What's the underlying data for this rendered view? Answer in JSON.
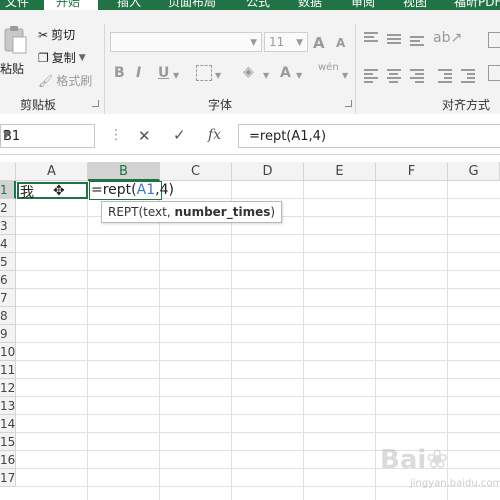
{
  "tabs": [
    {
      "label": "文件",
      "active": false
    },
    {
      "label": "开始",
      "active": true
    },
    {
      "label": "插入",
      "active": false
    },
    {
      "label": "页面布局",
      "active": false
    },
    {
      "label": "公式",
      "active": false
    },
    {
      "label": "数据",
      "active": false
    },
    {
      "label": "审阅",
      "active": false
    },
    {
      "label": "视图",
      "active": false
    },
    {
      "label": "福昕PDF",
      "active": false
    }
  ],
  "clipboard": {
    "paste_label": "粘贴",
    "cut_label": "剪切",
    "copy_label": "复制",
    "format_painter_label": "格式刷",
    "group_label": "剪贴板"
  },
  "font": {
    "size": "11",
    "grow_icon": "A",
    "shrink_icon": "A",
    "bold": "B",
    "italic": "I",
    "underline": "U",
    "font_color_icon": "A",
    "phonetic_icon": "wén",
    "group_label": "字体"
  },
  "alignment": {
    "group_label": "对齐方式"
  },
  "formula_bar": {
    "name_box": "B1",
    "cancel_icon": "✕",
    "enter_icon": "✓",
    "fx_icon": "fx",
    "formula": "=rept(A1,4)"
  },
  "grid": {
    "columns": [
      "A",
      "B",
      "C",
      "D",
      "E",
      "F",
      "G"
    ],
    "selected_column": "B",
    "rows": [
      "1",
      "2",
      "3",
      "4",
      "5",
      "6",
      "7",
      "8",
      "9",
      "10",
      "11",
      "12",
      "13",
      "14",
      "15",
      "16",
      "17"
    ],
    "selected_row": "1",
    "cells": {
      "A1": "我",
      "B1_prefix": "=rept(",
      "B1_ref": "A1",
      "B1_suffix": ",4)"
    }
  },
  "tooltip": {
    "func": "REPT(text, ",
    "arg_bold": "number_times",
    "close": ")"
  },
  "watermark": {
    "text": "Bai❀",
    "sub": "jingyan.baidu.com"
  }
}
